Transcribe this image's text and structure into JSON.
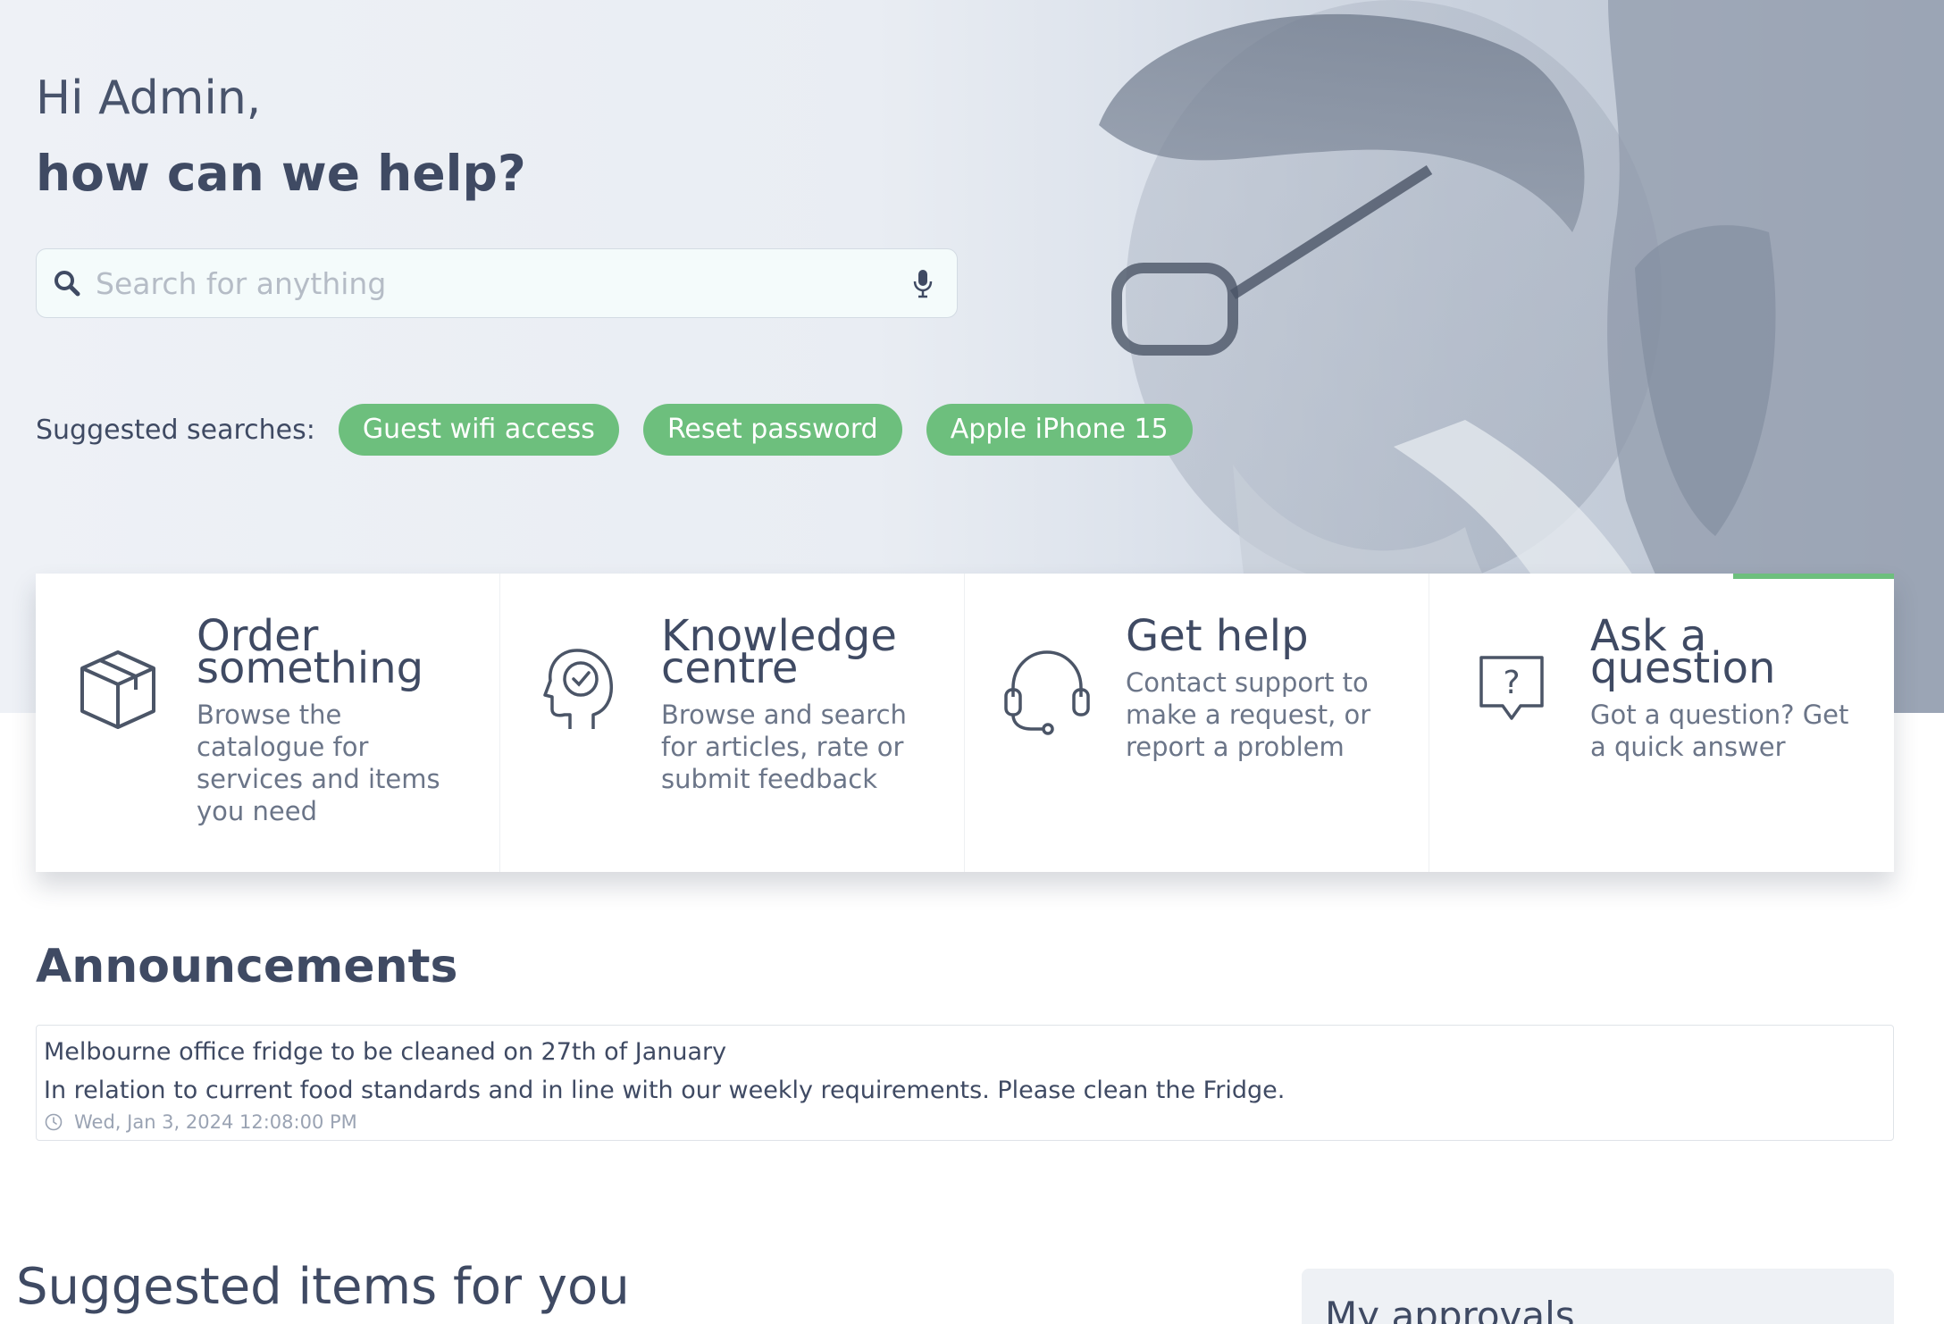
{
  "greeting": "Hi Admin,",
  "tagline": "how can we help?",
  "search": {
    "placeholder": "Search for anything"
  },
  "suggested": {
    "label": "Suggested searches:",
    "chips": [
      "Guest wifi access",
      "Reset password",
      "Apple iPhone 15"
    ]
  },
  "cards": [
    {
      "title_line1": "Order",
      "title_line2": "something",
      "description": "Browse the catalogue for services and items you need",
      "icon": "box-icon"
    },
    {
      "title_line1": "Knowledge",
      "title_line2": "centre",
      "description": "Browse and search for articles, rate or submit feedback",
      "icon": "head-check-icon"
    },
    {
      "title_line1": "Get help",
      "title_line2": "",
      "description": "Contact support to make a request, or report a problem",
      "icon": "headset-icon"
    },
    {
      "title_line1": "Ask a",
      "title_line2": "question",
      "description": "Got a question? Get a quick answer",
      "icon": "question-bubble-icon"
    }
  ],
  "announcements": {
    "title": "Announcements",
    "items": [
      {
        "headline": "Melbourne office fridge to be cleaned on 27th of January",
        "body": "In relation to current food standards and in line with our weekly requirements. Please clean the Fridge.",
        "date": "Wed, Jan 3, 2024 12:08:00 PM"
      }
    ]
  },
  "suggested_items_title": "Suggested items for you",
  "approvals_title": "My approvals",
  "colors": {
    "accent": "#6dbf7d",
    "text": "#3f4a63",
    "muted": "#6b7588"
  }
}
